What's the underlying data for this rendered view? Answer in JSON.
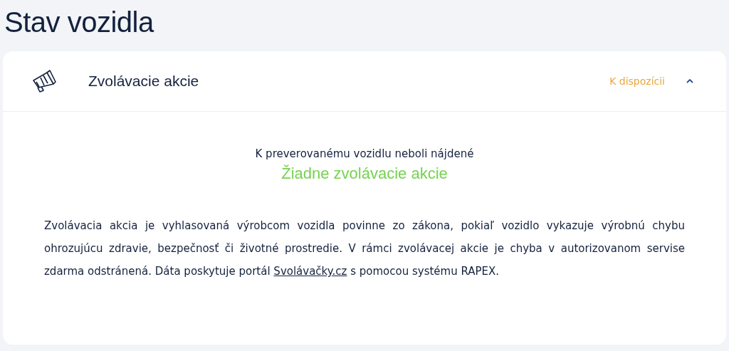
{
  "page_title": "Stav vozidla",
  "section": {
    "title": "Zvolávacie akcie",
    "status": "K dispozícii",
    "expanded": true,
    "result_intro": "K preverovanému vozidlu neboli nájdené",
    "result": "Žiadne zvolávacie akcie",
    "description": {
      "before": "Zvolávacia akcia je vyhlasovaná výrobcom vozidla povinne zo zákona, pokiaľ vozidlo vykazuje výrobnú chybu ohrozujúcu zdravie, bezpečnosť či životné prostredie. V rámci zvolávacej akcie je chyba v autorizovanom servise zdarma odstránená. Dáta poskytuje portál",
      "link": "Svolávačky.cz",
      "after": "s pomocou systému RAPEX."
    }
  }
}
